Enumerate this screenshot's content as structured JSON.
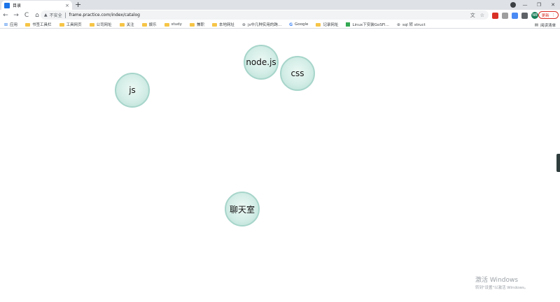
{
  "tab": {
    "title": "目录",
    "close": "×",
    "new_tab": "+"
  },
  "window": {
    "minimize": "—",
    "restore": "❐",
    "close": "✕"
  },
  "toolbar": {
    "back": "←",
    "forward": "→",
    "reload": "C",
    "home": "⌂",
    "security_label": "不安全",
    "url": "frame.practice.com/index/catalog",
    "update_label": "更新",
    "profile_initials": "NB"
  },
  "bookmarks": [
    {
      "label": "应用",
      "icon": "apps-icon"
    },
    {
      "label": "书签工具栏",
      "icon": "folder-icon"
    },
    {
      "label": "工具网页",
      "icon": "folder-icon"
    },
    {
      "label": "公司网址",
      "icon": "folder-icon"
    },
    {
      "label": "关注",
      "icon": "folder-icon"
    },
    {
      "label": "娱乐",
      "icon": "folder-icon"
    },
    {
      "label": "study",
      "icon": "folder-icon"
    },
    {
      "label": "兼职",
      "icon": "folder-icon"
    },
    {
      "label": "本地网址",
      "icon": "folder-icon"
    },
    {
      "label": "js中几种实用的跨...",
      "icon": "globe-icon"
    },
    {
      "label": "Google",
      "icon": "google-icon"
    },
    {
      "label": "记录网址",
      "icon": "folder-icon"
    },
    {
      "label": "Linux下安装GoSFl...",
      "icon": "green-icon"
    },
    {
      "label": "sql 转 struct",
      "icon": "globe-icon"
    }
  ],
  "reading_list": "阅读清单",
  "catalog": {
    "items": [
      {
        "label": "node.js"
      },
      {
        "label": "css"
      },
      {
        "label": "js"
      },
      {
        "label": "聊天室"
      }
    ]
  },
  "watermark": {
    "title": "激活 Windows",
    "subtitle": "转到\"设置\"以激活 Windows。"
  }
}
